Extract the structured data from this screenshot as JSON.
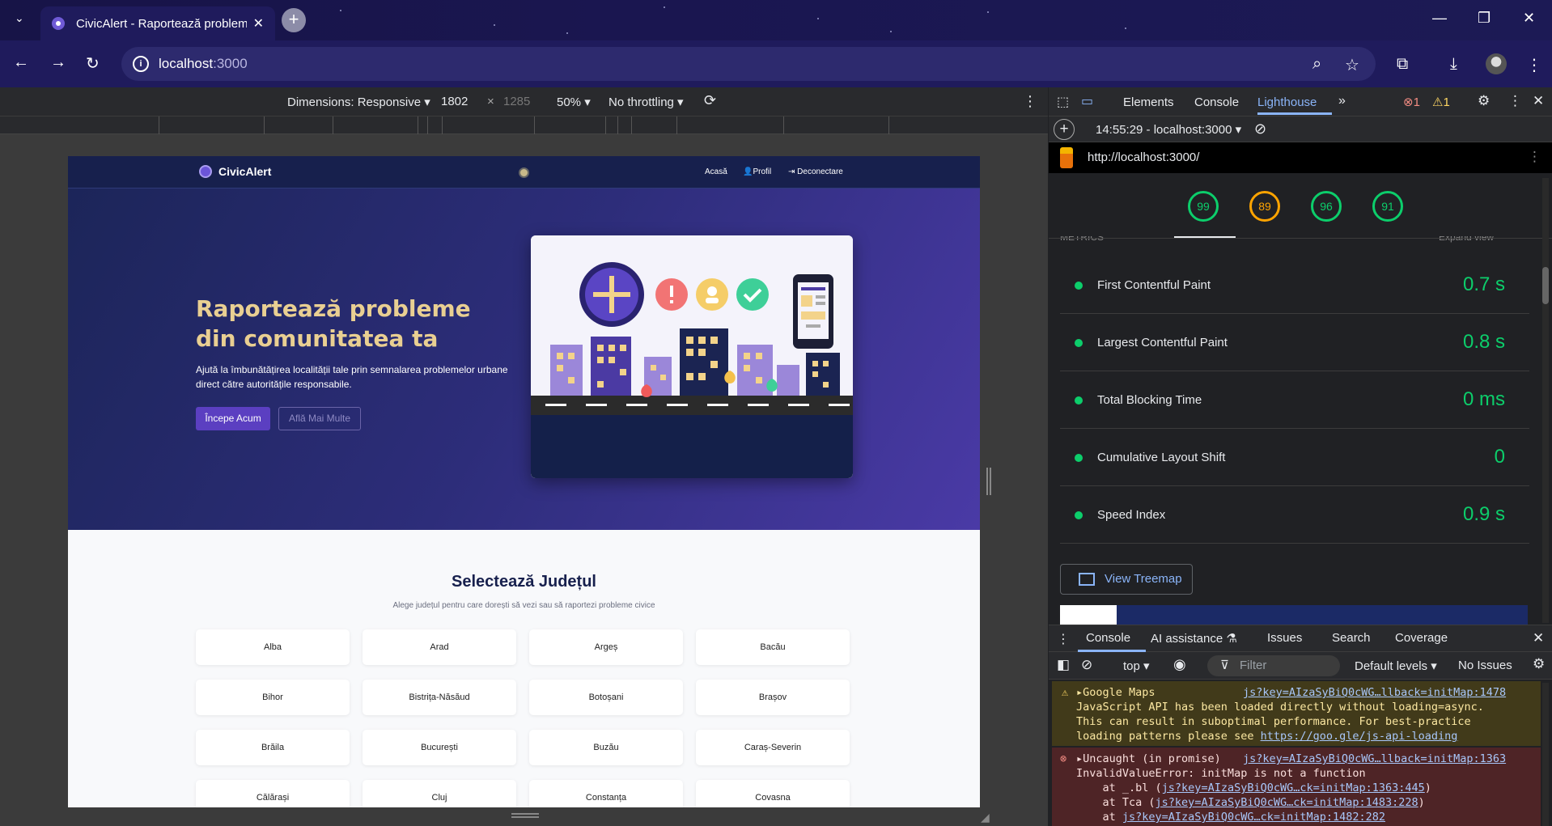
{
  "browser": {
    "tab_title": "CivicAlert - Raportează probleme",
    "tab_close": "✕",
    "new_tab": "+",
    "url_host": "localhost",
    "url_port": ":3000"
  },
  "device_toolbar": {
    "dimensions": "Dimensions: Responsive ▾",
    "width": "1802",
    "times": "×",
    "height": "1285",
    "zoom": "50% ▾",
    "throttling": "No throttling ▾"
  },
  "site": {
    "brand": "CivicAlert",
    "nav": [
      "Acasă",
      "Profil",
      "Deconectare"
    ],
    "hero_title": "Raportează probleme din comunitatea ta",
    "hero_sub": "Ajută la îmbunătățirea localității tale prin semnalarea problemelor urbane direct către autoritățile responsabile.",
    "btn_primary": "Începe Acum",
    "btn_secondary": "Află Mai Multe",
    "section_title": "Selectează Județul",
    "section_sub": "Alege județul pentru care dorești să vezi sau să raportezi probleme civice",
    "counties": [
      "Alba",
      "Arad",
      "Argeș",
      "Bacău",
      "Bihor",
      "Bistrița-Năsăud",
      "Botoșani",
      "Brașov",
      "Brăila",
      "București",
      "Buzău",
      "Caraș-Severin",
      "Călărași",
      "Cluj",
      "Constanța",
      "Covasna"
    ]
  },
  "devtools": {
    "tabs": [
      "Elements",
      "Console",
      "Lighthouse"
    ],
    "active_tab": "Lighthouse",
    "error_count": "1",
    "warning_count": "1",
    "report_select": "14:55:29 - localhost:3000 ▾",
    "audited_url": "http://localhost:3000/",
    "scores": [
      99,
      89,
      96,
      91
    ],
    "metrics_header": "METRICS",
    "expand_view": "Expand view",
    "metrics": [
      {
        "name": "First Contentful Paint",
        "value": "0.7 s"
      },
      {
        "name": "Largest Contentful Paint",
        "value": "0.8 s"
      },
      {
        "name": "Total Blocking Time",
        "value": "0 ms"
      },
      {
        "name": "Cumulative Layout Shift",
        "value": "0"
      },
      {
        "name": "Speed Index",
        "value": "0.9 s"
      }
    ],
    "view_treemap": "View Treemap"
  },
  "drawer": {
    "tabs": [
      "Console",
      "AI assistance",
      "Issues",
      "Search",
      "Coverage"
    ],
    "context": "top ▾",
    "filter_placeholder": "Filter",
    "levels": "Default levels ▾",
    "issues": "No Issues",
    "warning": {
      "title": "▸Google Maps",
      "source": "js?key=AIzaSyBiQ0cWG…llback=initMap:1478",
      "line1": "JavaScript API has been loaded directly without loading=async.",
      "line2": "This can result in suboptimal performance. For best-practice",
      "line3_prefix": "loading patterns please see ",
      "line3_link": "https://goo.gle/js-api-loading"
    },
    "error": {
      "title": "▸Uncaught (in promise)",
      "source": "js?key=AIzaSyBiQ0cWG…llback=initMap:1363",
      "line1": "InvalidValueError: initMap is not a function",
      "line2_prefix": "    at _.bl (",
      "line2_link": "js?key=AIzaSyBiQ0cWG…ck=initMap:1363:445",
      "line2_suffix": ")",
      "line3_prefix": "    at Tca (",
      "line3_link": "js?key=AIzaSyBiQ0cWG…ck=initMap:1483:228",
      "line3_suffix": ")",
      "line4_prefix": "    at ",
      "line4_link": "js?key=AIzaSyBiQ0cWG…ck=initMap:1482:282"
    }
  }
}
